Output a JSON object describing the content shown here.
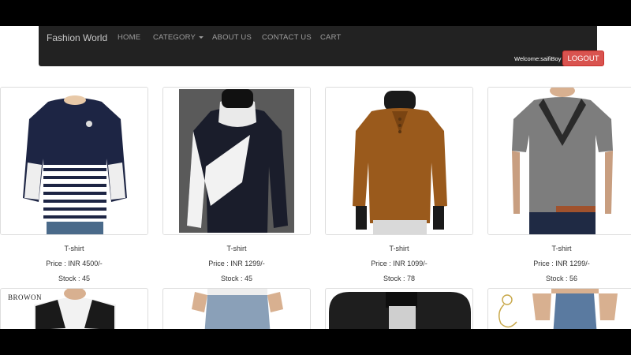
{
  "navbar": {
    "brand": "Fashion World",
    "items": [
      "HOME",
      "CATEGORY",
      "ABOUT US",
      "CONTACT US",
      "CART"
    ],
    "welcome": "Welcome:saifiBoy",
    "logout": "LOGOUT"
  },
  "products": [
    {
      "name": "T-shirt",
      "price": "Price : INR 4500/-",
      "stock": "Stock : 45"
    },
    {
      "name": "T-shirt",
      "price": "Price : INR 1299/-",
      "stock": "Stock : 45"
    },
    {
      "name": "T-shirt",
      "price": "Price : INR 1099/-",
      "stock": "Stock : 78"
    },
    {
      "name": "T-shirt",
      "price": "Price : INR 1299/-",
      "stock": "Stock : 56"
    }
  ],
  "second_row": {
    "brand_logo_text": "BROWON"
  },
  "colors": {
    "navbar_bg": "#222222",
    "logout_bg": "#d9534f"
  }
}
